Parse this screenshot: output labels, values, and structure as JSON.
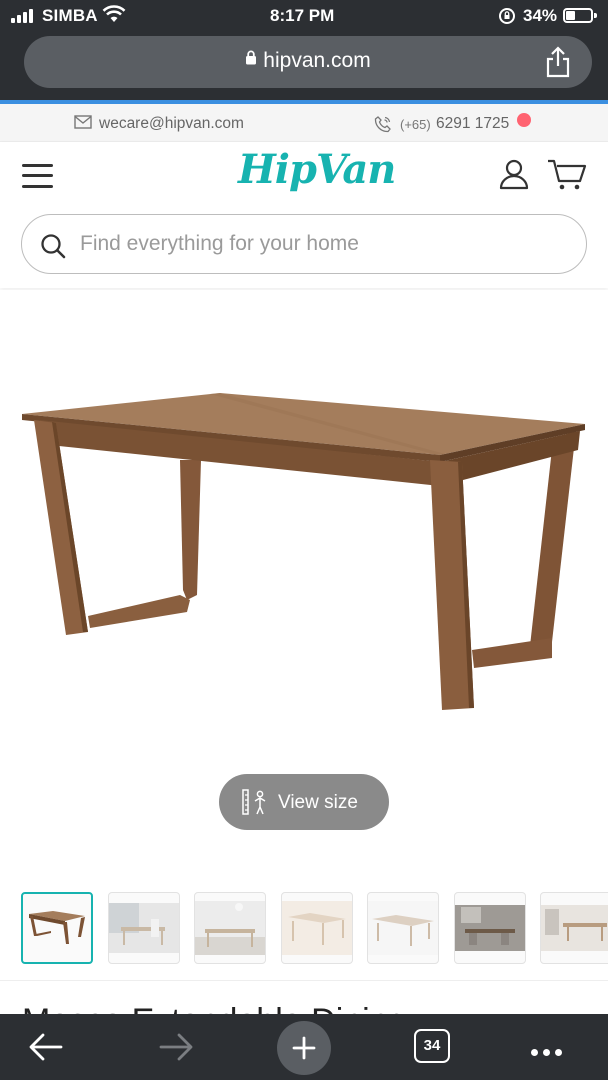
{
  "status_bar": {
    "carrier": "SIMBA",
    "time": "8:17 PM",
    "battery_percent": "34%",
    "battery_level": 0.34,
    "icons": [
      "signal-icon",
      "wifi-icon",
      "orientation-lock-icon",
      "battery-icon"
    ]
  },
  "browser": {
    "url": "hipvan.com",
    "open_tabs": "34",
    "colors": {
      "chrome": "#2c2f33",
      "url_bar": "#5a5e63",
      "progress": "#3b8fe0"
    }
  },
  "contact": {
    "email": "wecare@hipvan.com",
    "phone_prefix": "(+65)",
    "phone": "6291 1725"
  },
  "header": {
    "logo_text": "HipVan",
    "search_placeholder": "Find everything for your home",
    "brand_color": "#17b3b0"
  },
  "product": {
    "view_size_label": "View size",
    "thumbnail_count": 7,
    "active_thumbnail": 0,
    "title_partial": "Mosco Extendable Dining"
  }
}
